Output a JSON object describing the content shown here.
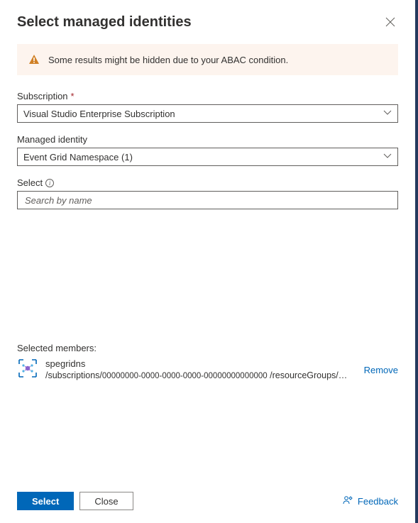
{
  "header": {
    "title": "Select managed identities"
  },
  "alert": {
    "message": "Some results might be hidden due to your ABAC condition."
  },
  "fields": {
    "subscription": {
      "label": "Subscription",
      "value": "Visual Studio Enterprise Subscription",
      "required": "*"
    },
    "managedIdentity": {
      "label": "Managed identity",
      "value": "Event Grid Namespace (1)"
    },
    "select": {
      "label": "Select",
      "placeholder": "Search by name"
    }
  },
  "selected": {
    "heading": "Selected members:",
    "member": {
      "name": "spegridns",
      "pathPrefix": "/subscriptions/",
      "pathGuid": "00000000-0000-0000-0000-00000000000000",
      "pathSuffix": "/resourceGroups/sp…"
    },
    "removeLabel": "Remove"
  },
  "footer": {
    "primary": "Select",
    "secondary": "Close",
    "feedback": "Feedback"
  }
}
